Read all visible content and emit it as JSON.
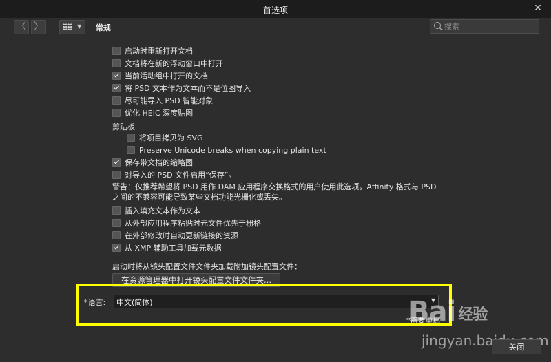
{
  "window": {
    "title": "首选项",
    "close_glyph": "✕"
  },
  "toolbar": {
    "back_glyph": "〈",
    "forward_glyph": "〉",
    "tab_label": "常规",
    "search_placeholder": "搜索"
  },
  "checkboxes": [
    {
      "label": "启动时重新打开文档",
      "checked": false
    },
    {
      "label": "文档将在新的浮动窗口中打开",
      "checked": false
    },
    {
      "label": "当前活动组中打开的文档",
      "checked": true
    },
    {
      "label": "将 PSD 文本作为文本而不是位图导入",
      "checked": true
    },
    {
      "label": "尽可能导入 PSD 智能对象",
      "checked": false
    },
    {
      "label": "优化 HEIC 深度贴图",
      "checked": false
    }
  ],
  "clipboard": {
    "heading": "剪贴板",
    "items": [
      {
        "label": "将项目拷贝为 SVG",
        "checked": false
      },
      {
        "label": "Preserve Unicode breaks when copying plain text",
        "checked": false
      }
    ]
  },
  "checkboxes2": [
    {
      "label": "保存带文档的缩略图",
      "checked": true
    },
    {
      "label": "对导入的 PSD 文件启用“保存”。",
      "checked": false
    }
  ],
  "warning": "警告：仅推荐希望将 PSD 用作 DAM 应用程序交换格式的用户使用此选项。Affinity 格式与 PSD 之间的不兼容可能导致某些文档功能光栅化或丢失。",
  "checkboxes3": [
    {
      "label": "插入填充文本作为文本",
      "checked": false
    },
    {
      "label": "从外部应用程序粘贴时元文件优先于栅格",
      "checked": false
    },
    {
      "label": "在外部修改时自动更新链接的资源",
      "checked": false
    },
    {
      "label": "从 XMP 辅助工具加载元数据",
      "checked": true
    }
  ],
  "lens": {
    "label": "启动时将从镜头配置文件文件夹加载附加镜头配置文件：",
    "button": "在资源管理器中打开镜头配置文件文件夹..."
  },
  "language": {
    "label": "*语言:",
    "value": "中文(简体)",
    "restart_note": "*需要重启"
  },
  "watermark": {
    "line1": "Bai",
    "line1_cn": "经验",
    "line2": "jingyan.baidu.com"
  },
  "footer": {
    "close_label": "关闭"
  },
  "colors": {
    "background": "#2d2d2d",
    "titlebar": "#1c1c1c",
    "highlight": "#ffff00"
  }
}
